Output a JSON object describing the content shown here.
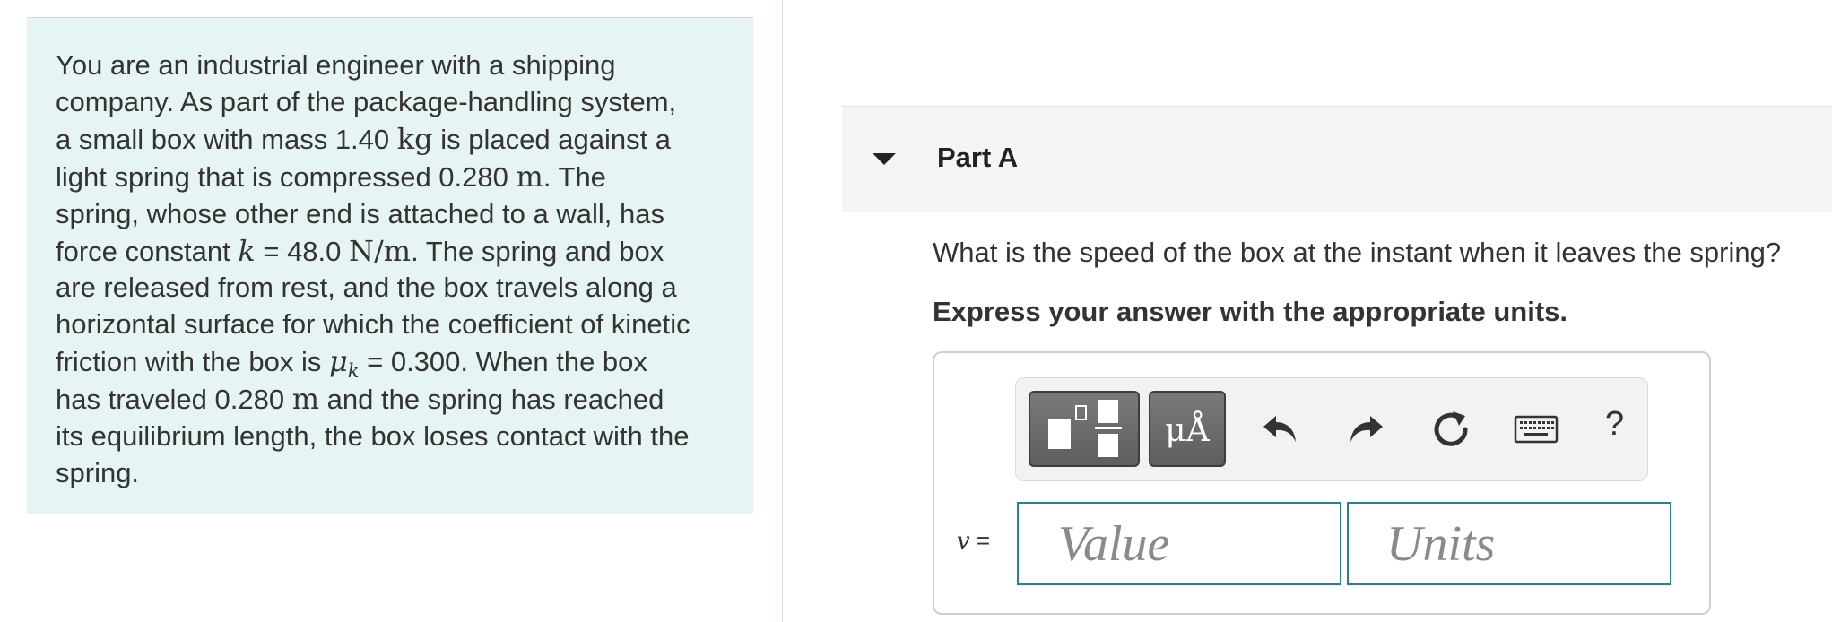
{
  "problem": {
    "lines": [
      [
        {
          "t": "You are an industrial engineer with a shipping"
        }
      ],
      [
        {
          "t": "company. As part of the package-handling system,"
        }
      ],
      [
        {
          "t": "a small box with mass 1.40 "
        },
        {
          "t": "kg",
          "m": "math"
        },
        {
          "t": " is placed against a"
        }
      ],
      [
        {
          "t": "light spring that is compressed 0.280 "
        },
        {
          "t": "m",
          "m": "math"
        },
        {
          "t": ". The"
        }
      ],
      [
        {
          "t": "spring, whose other end is attached to a wall, has"
        }
      ],
      [
        {
          "t": "force constant "
        },
        {
          "t": "k",
          "m": "math-italic"
        },
        {
          "t": " = 48.0 "
        },
        {
          "t": "N/m",
          "m": "math"
        },
        {
          "t": ". The spring and box"
        }
      ],
      [
        {
          "t": "are released from rest, and the box travels along a"
        }
      ],
      [
        {
          "t": "horizontal surface for which the coefficient of kinetic"
        }
      ],
      [
        {
          "t": "friction with the box is "
        },
        {
          "t": "μ",
          "m": "math-italic",
          "sub": "k"
        },
        {
          "t": " = 0.300. When the box"
        }
      ],
      [
        {
          "t": "has traveled 0.280 "
        },
        {
          "t": "m",
          "m": "math"
        },
        {
          "t": " and the spring has reached"
        }
      ],
      [
        {
          "t": "its equilibrium length, the box loses contact with the"
        }
      ],
      [
        {
          "t": "spring."
        }
      ]
    ]
  },
  "part": {
    "title": "Part A",
    "question": "What is the speed of the box at the instant when it leaves the spring?",
    "instruction": "Express your answer with the appropriate units."
  },
  "toolbar": {
    "templates_icon": "templates-icon",
    "units_label": "μÅ",
    "undo_icon": "undo-icon",
    "redo_icon": "redo-icon",
    "reset_icon": "reset-icon",
    "keyboard_icon": "keyboard-icon",
    "help_label": "?"
  },
  "answer": {
    "variable": "v",
    "equals": " =",
    "value_placeholder": "Value",
    "value": "",
    "units_placeholder": "Units",
    "units": ""
  },
  "colors": {
    "problem_background": "#e6f4f3",
    "input_border": "#2b7f91",
    "toolbar_button": "#6e6e6e"
  }
}
